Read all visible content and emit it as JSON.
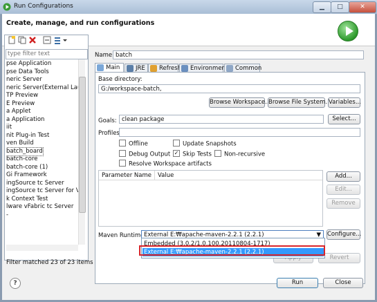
{
  "window": {
    "title": "Run Configurations"
  },
  "header": {
    "title": "Create, manage, and run configurations"
  },
  "left_panel": {
    "filter_placeholder": "type filter text",
    "tree_items": [
      "pse Application",
      "pse Data Tools",
      "neric Server",
      "neric Server(External Launch)",
      "TP Preview",
      "E Preview",
      "a Applet",
      "a Application",
      "iit",
      "nit Plug-in Test",
      "ven Build",
      "batch_board",
      "batch-core",
      "batch-core (1)",
      "Gi Framework",
      "ingSource tc Server",
      "ingSource tc Server for VMw",
      "k Context Test",
      "lware vFabric tc Server",
      "-"
    ],
    "selected_item": "batch_board",
    "status": "Filter matched 23 of 23 items"
  },
  "config": {
    "name_label": "Name:",
    "name_value": "batch",
    "tabs": [
      "Main",
      "JRE",
      "Refresh",
      "Environment",
      "Common"
    ],
    "active_tab": "Main",
    "base_dir_label": "Base directory:",
    "base_dir_value": "G:/workspace-batch,",
    "browse_workspace": "Browse Workspace...",
    "browse_file_system": "Browse File System...",
    "variables": "Variables...",
    "goals_label": "Goals:",
    "goals_value": "clean package",
    "select": "Select...",
    "profiles_label": "Profiles:",
    "profiles_value": "",
    "checkboxes": {
      "offline": {
        "label": "Offline",
        "checked": false
      },
      "update_snapshots": {
        "label": "Update Snapshots",
        "checked": false
      },
      "debug_output": {
        "label": "Debug Output",
        "checked": false
      },
      "skip_tests": {
        "label": "Skip Tests",
        "checked": true
      },
      "non_recursive": {
        "label": "Non-recursive",
        "checked": false
      },
      "resolve_workspace": {
        "label": "Resolve Workspace artifacts",
        "checked": false
      }
    },
    "param_headers": [
      "Parameter Name",
      "Value"
    ],
    "add": "Add...",
    "edit": "Edit...",
    "remove": "Remove",
    "runtime_label": "Maven Runtime:",
    "runtime_value": "External E:₩apache-maven-2.2.1 (2.2.1)",
    "configure": "Configure...",
    "runtime_options": [
      "Embedded (3.0.2/1.0.100.20110804-1717)",
      "External E:₩apache-maven-2.2.1 (2.2.1)"
    ],
    "apply": "Apply",
    "revert": "Revert"
  },
  "footer": {
    "run": "Run",
    "close": "Close"
  },
  "colors": {
    "selection": "#3399ff",
    "highlight_border": "#d9252a",
    "run_icon": "#2e9a2c"
  }
}
